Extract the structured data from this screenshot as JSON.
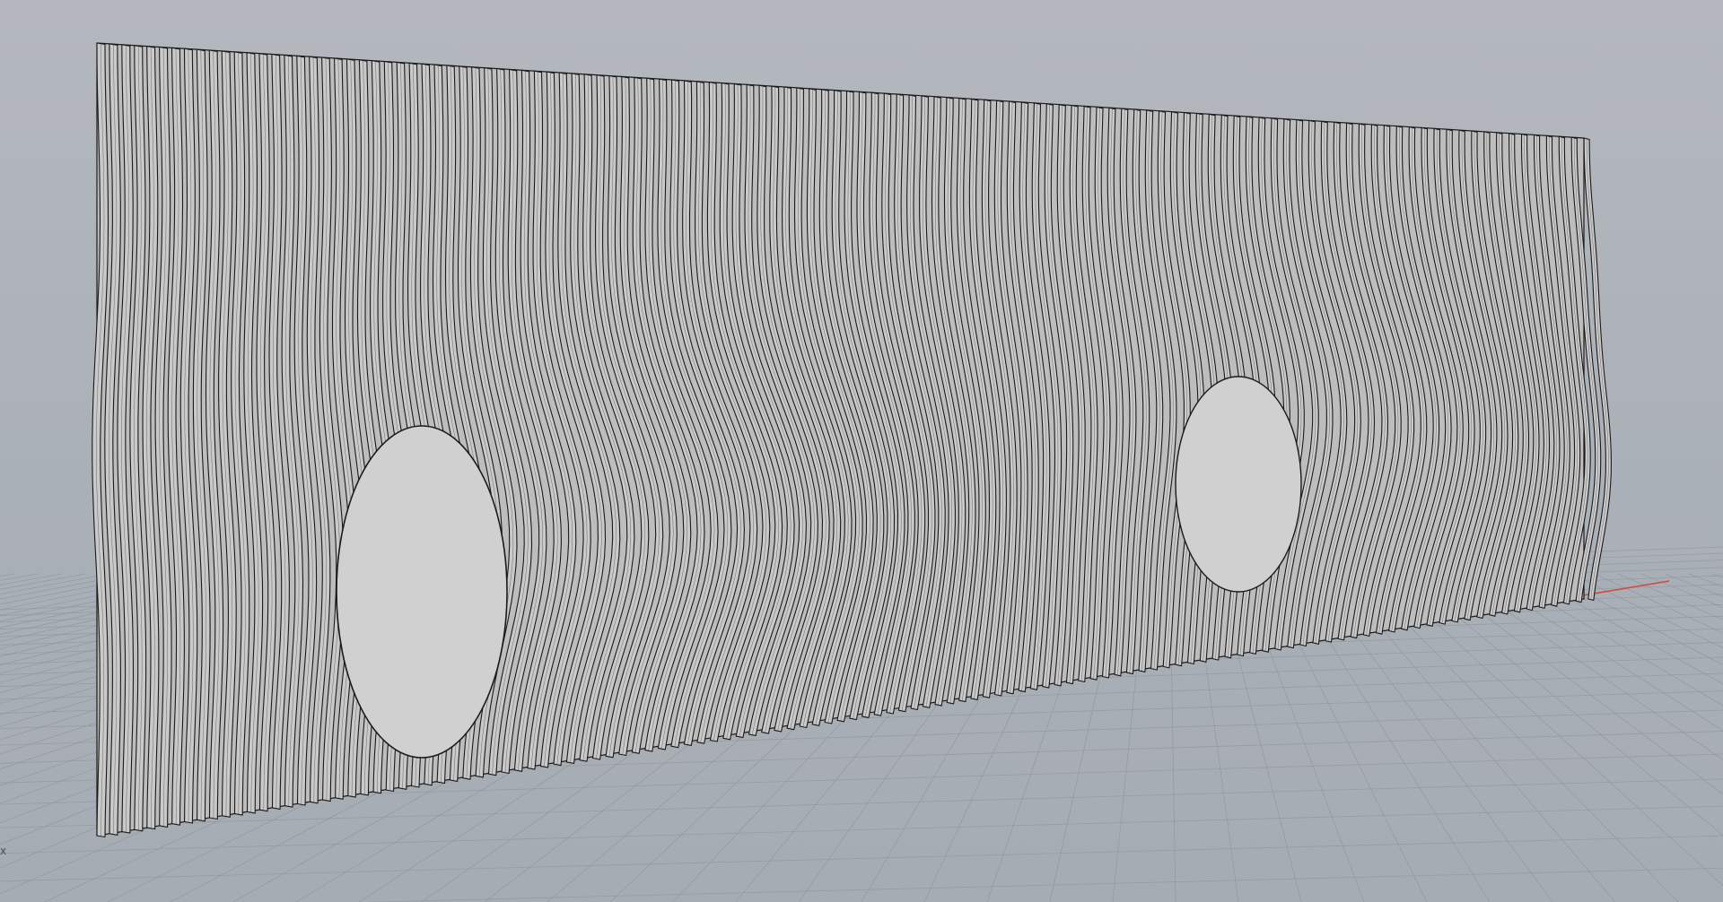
{
  "viewport": {
    "projection": "perspective",
    "display_mode": "shaded",
    "background_color": "#aab0b7",
    "grid": true,
    "grid_color": "#8f959c",
    "world_axes": {
      "x_color": "#d24a3c",
      "y_color": "#5a8a5a"
    }
  },
  "model": {
    "description_type": "sliced-panel-relief",
    "fill_color": "#c9c9c9",
    "stroke_color": "#1a1a1a"
  },
  "axis_label": "x"
}
